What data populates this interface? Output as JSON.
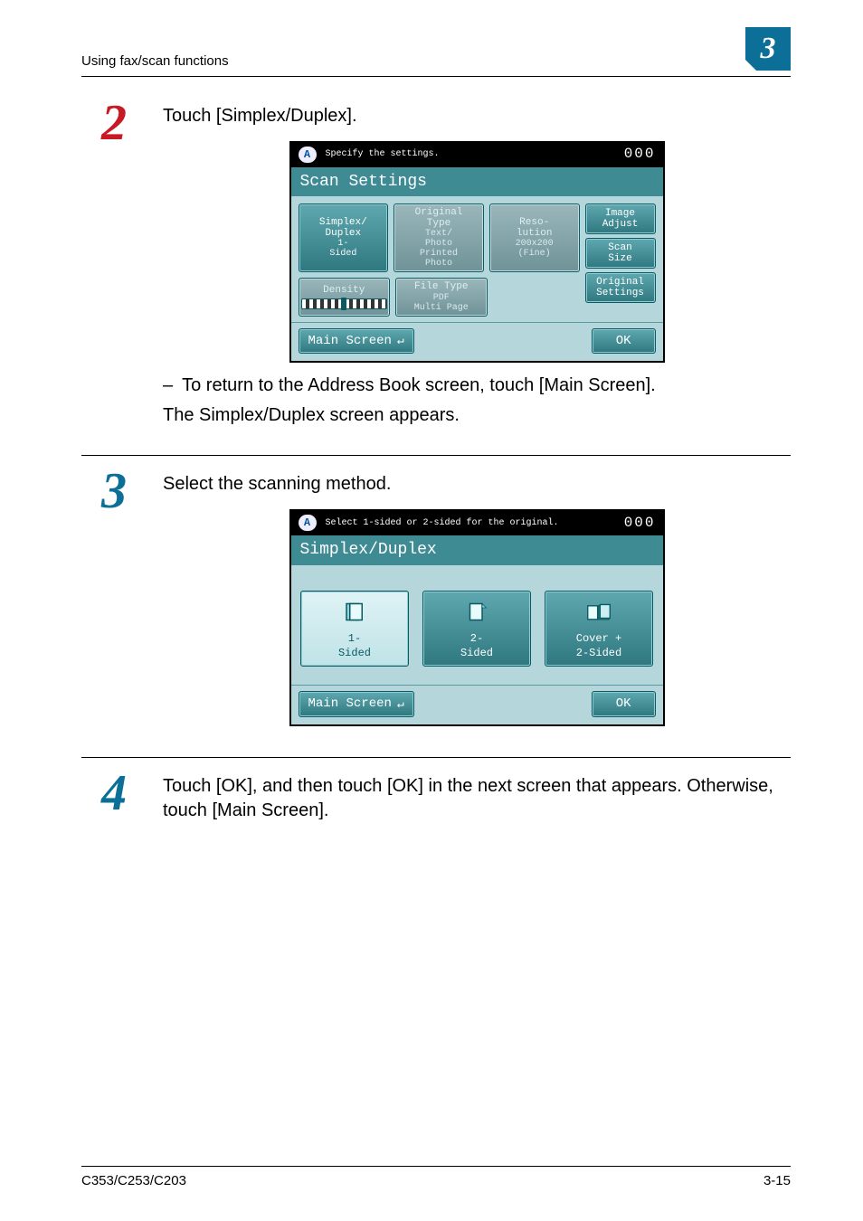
{
  "header": {
    "running_title": "Using fax/scan functions",
    "chapter_badge": "3"
  },
  "steps": {
    "s2": {
      "num": "2",
      "text": "Touch [Simplex/Duplex].",
      "note_dash": "To return to the Address Book screen, touch [Main Screen].",
      "followup": "The Simplex/Duplex screen appears."
    },
    "s3": {
      "num": "3",
      "text": "Select the scanning method."
    },
    "s4": {
      "num": "4",
      "text": "Touch [OK], and then touch [OK] in the next screen that appears. Otherwise, touch [Main Screen]."
    }
  },
  "device1": {
    "topbar_msg": "Specify the settings.",
    "copy_count": "000",
    "title": "Scan Settings",
    "tiles": {
      "simplex_hdr": "Simplex/\nDuplex",
      "simplex_val": "1-\nSided",
      "orig_hdr": "Original\nType",
      "orig_val1": "Text/\nPhoto",
      "orig_val2": "Printed\nPhoto",
      "res_hdr": "Reso-\nlution",
      "res_val1": "200x200",
      "res_val2": "(Fine)",
      "density_hdr": "Density",
      "file_hdr": "File Type",
      "file_val1": "PDF",
      "file_val2": "Multi Page",
      "side_image": "Image\nAdjust",
      "side_scan": "Scan\nSize",
      "side_orig": "Original\nSettings"
    },
    "footer_main": "Main Screen",
    "footer_ok": "OK"
  },
  "device2": {
    "topbar_msg": "Select 1-sided or 2-sided for the original.",
    "copy_count": "000",
    "title": "Simplex/Duplex",
    "opt1": "1-\nSided",
    "opt2": "2-\nSided",
    "opt3": "Cover +\n2-Sided",
    "footer_main": "Main Screen",
    "footer_ok": "OK"
  },
  "footer": {
    "model": "C353/C253/C203",
    "page": "3-15"
  }
}
